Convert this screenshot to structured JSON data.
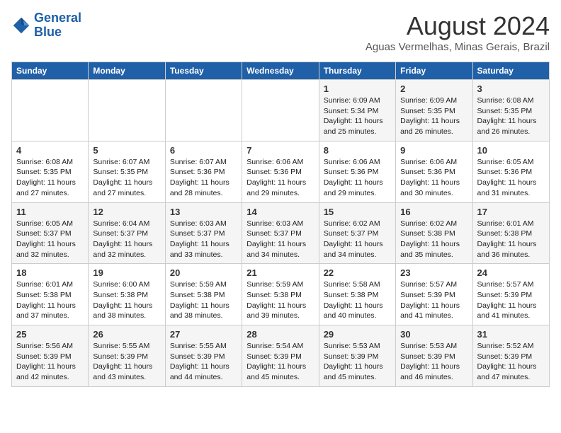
{
  "header": {
    "logo_line1": "General",
    "logo_line2": "Blue",
    "month_year": "August 2024",
    "location": "Aguas Vermelhas, Minas Gerais, Brazil"
  },
  "weekdays": [
    "Sunday",
    "Monday",
    "Tuesday",
    "Wednesday",
    "Thursday",
    "Friday",
    "Saturday"
  ],
  "weeks": [
    [
      {
        "day": "",
        "info": ""
      },
      {
        "day": "",
        "info": ""
      },
      {
        "day": "",
        "info": ""
      },
      {
        "day": "",
        "info": ""
      },
      {
        "day": "1",
        "info": "Sunrise: 6:09 AM\nSunset: 5:34 PM\nDaylight: 11 hours and 25 minutes."
      },
      {
        "day": "2",
        "info": "Sunrise: 6:09 AM\nSunset: 5:35 PM\nDaylight: 11 hours and 26 minutes."
      },
      {
        "day": "3",
        "info": "Sunrise: 6:08 AM\nSunset: 5:35 PM\nDaylight: 11 hours and 26 minutes."
      }
    ],
    [
      {
        "day": "4",
        "info": "Sunrise: 6:08 AM\nSunset: 5:35 PM\nDaylight: 11 hours and 27 minutes."
      },
      {
        "day": "5",
        "info": "Sunrise: 6:07 AM\nSunset: 5:35 PM\nDaylight: 11 hours and 27 minutes."
      },
      {
        "day": "6",
        "info": "Sunrise: 6:07 AM\nSunset: 5:36 PM\nDaylight: 11 hours and 28 minutes."
      },
      {
        "day": "7",
        "info": "Sunrise: 6:06 AM\nSunset: 5:36 PM\nDaylight: 11 hours and 29 minutes."
      },
      {
        "day": "8",
        "info": "Sunrise: 6:06 AM\nSunset: 5:36 PM\nDaylight: 11 hours and 29 minutes."
      },
      {
        "day": "9",
        "info": "Sunrise: 6:06 AM\nSunset: 5:36 PM\nDaylight: 11 hours and 30 minutes."
      },
      {
        "day": "10",
        "info": "Sunrise: 6:05 AM\nSunset: 5:36 PM\nDaylight: 11 hours and 31 minutes."
      }
    ],
    [
      {
        "day": "11",
        "info": "Sunrise: 6:05 AM\nSunset: 5:37 PM\nDaylight: 11 hours and 32 minutes."
      },
      {
        "day": "12",
        "info": "Sunrise: 6:04 AM\nSunset: 5:37 PM\nDaylight: 11 hours and 32 minutes."
      },
      {
        "day": "13",
        "info": "Sunrise: 6:03 AM\nSunset: 5:37 PM\nDaylight: 11 hours and 33 minutes."
      },
      {
        "day": "14",
        "info": "Sunrise: 6:03 AM\nSunset: 5:37 PM\nDaylight: 11 hours and 34 minutes."
      },
      {
        "day": "15",
        "info": "Sunrise: 6:02 AM\nSunset: 5:37 PM\nDaylight: 11 hours and 34 minutes."
      },
      {
        "day": "16",
        "info": "Sunrise: 6:02 AM\nSunset: 5:38 PM\nDaylight: 11 hours and 35 minutes."
      },
      {
        "day": "17",
        "info": "Sunrise: 6:01 AM\nSunset: 5:38 PM\nDaylight: 11 hours and 36 minutes."
      }
    ],
    [
      {
        "day": "18",
        "info": "Sunrise: 6:01 AM\nSunset: 5:38 PM\nDaylight: 11 hours and 37 minutes."
      },
      {
        "day": "19",
        "info": "Sunrise: 6:00 AM\nSunset: 5:38 PM\nDaylight: 11 hours and 38 minutes."
      },
      {
        "day": "20",
        "info": "Sunrise: 5:59 AM\nSunset: 5:38 PM\nDaylight: 11 hours and 38 minutes."
      },
      {
        "day": "21",
        "info": "Sunrise: 5:59 AM\nSunset: 5:38 PM\nDaylight: 11 hours and 39 minutes."
      },
      {
        "day": "22",
        "info": "Sunrise: 5:58 AM\nSunset: 5:38 PM\nDaylight: 11 hours and 40 minutes."
      },
      {
        "day": "23",
        "info": "Sunrise: 5:57 AM\nSunset: 5:39 PM\nDaylight: 11 hours and 41 minutes."
      },
      {
        "day": "24",
        "info": "Sunrise: 5:57 AM\nSunset: 5:39 PM\nDaylight: 11 hours and 41 minutes."
      }
    ],
    [
      {
        "day": "25",
        "info": "Sunrise: 5:56 AM\nSunset: 5:39 PM\nDaylight: 11 hours and 42 minutes."
      },
      {
        "day": "26",
        "info": "Sunrise: 5:55 AM\nSunset: 5:39 PM\nDaylight: 11 hours and 43 minutes."
      },
      {
        "day": "27",
        "info": "Sunrise: 5:55 AM\nSunset: 5:39 PM\nDaylight: 11 hours and 44 minutes."
      },
      {
        "day": "28",
        "info": "Sunrise: 5:54 AM\nSunset: 5:39 PM\nDaylight: 11 hours and 45 minutes."
      },
      {
        "day": "29",
        "info": "Sunrise: 5:53 AM\nSunset: 5:39 PM\nDaylight: 11 hours and 45 minutes."
      },
      {
        "day": "30",
        "info": "Sunrise: 5:53 AM\nSunset: 5:39 PM\nDaylight: 11 hours and 46 minutes."
      },
      {
        "day": "31",
        "info": "Sunrise: 5:52 AM\nSunset: 5:39 PM\nDaylight: 11 hours and 47 minutes."
      }
    ]
  ]
}
